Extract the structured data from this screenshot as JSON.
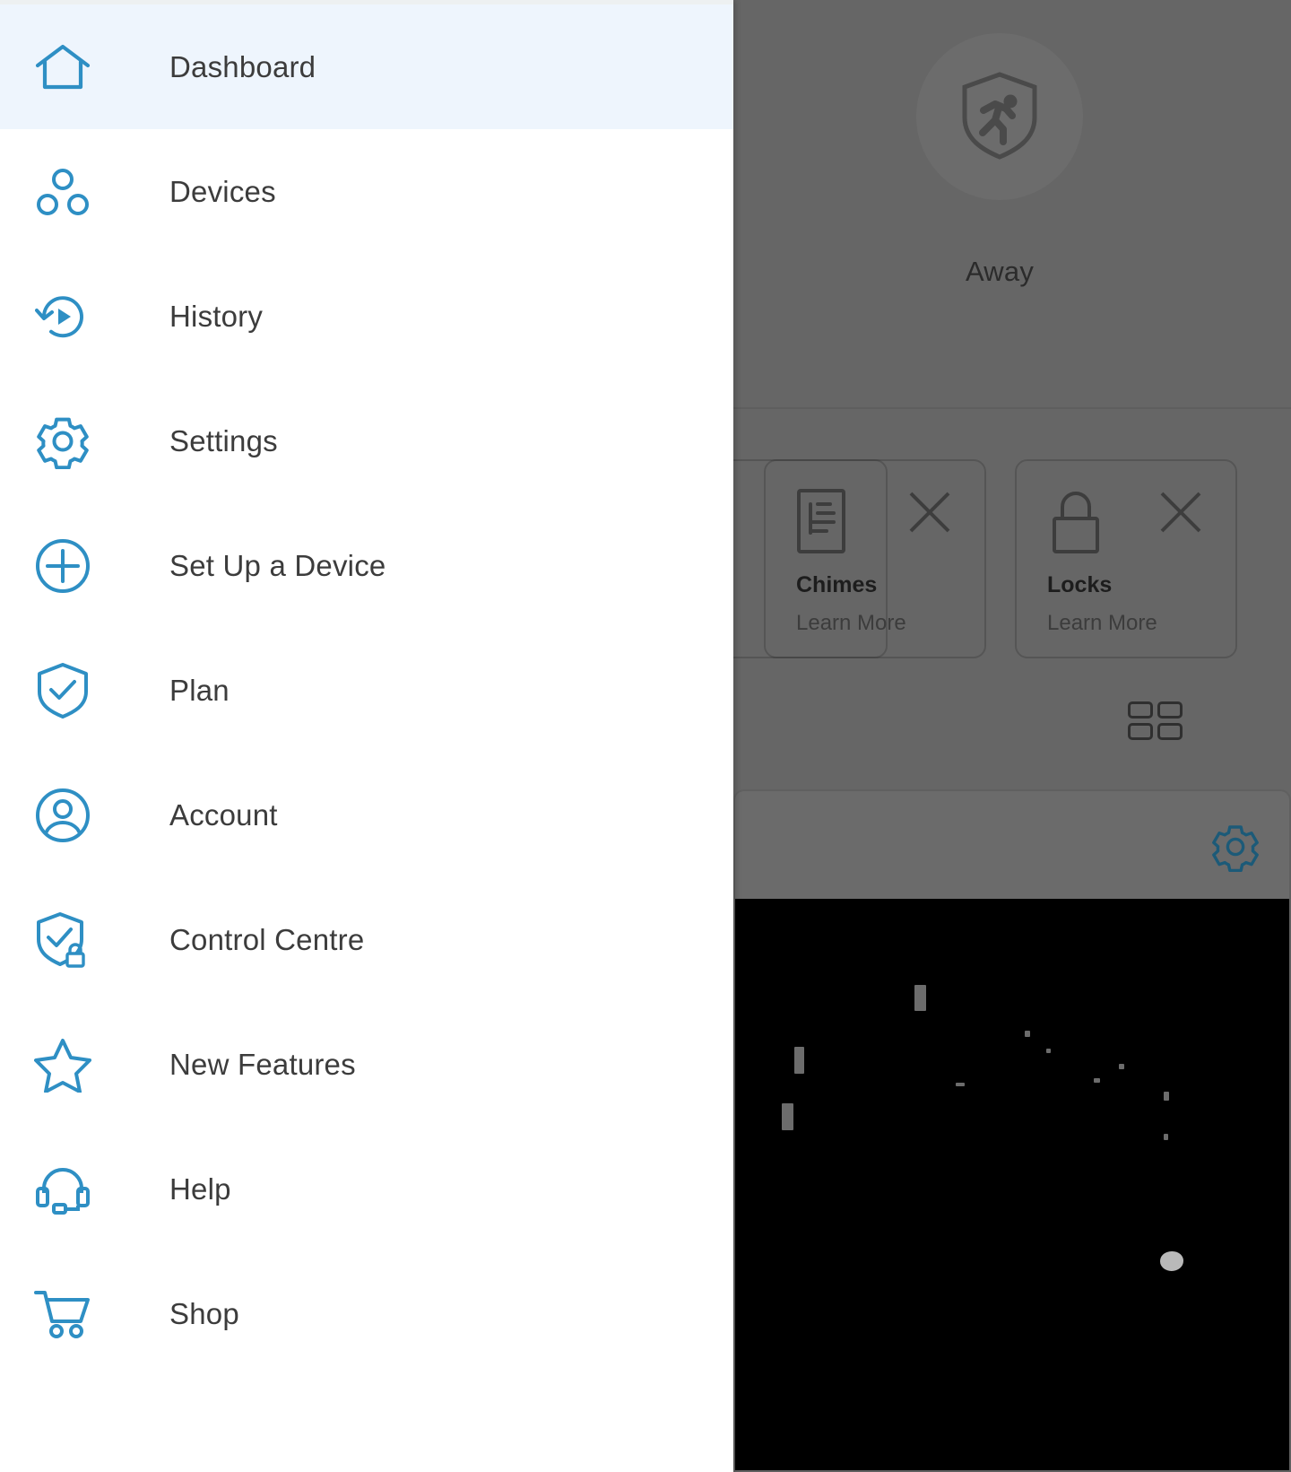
{
  "drawer": {
    "items": [
      {
        "label": "Dashboard",
        "icon": "home-icon",
        "active": true
      },
      {
        "label": "Devices",
        "icon": "devices-icon",
        "active": false
      },
      {
        "label": "History",
        "icon": "history-icon",
        "active": false
      },
      {
        "label": "Settings",
        "icon": "gear-icon",
        "active": false
      },
      {
        "label": "Set Up a Device",
        "icon": "plus-circle-icon",
        "active": false
      },
      {
        "label": "Plan",
        "icon": "shield-check-icon",
        "active": false
      },
      {
        "label": "Account",
        "icon": "user-circle-icon",
        "active": false
      },
      {
        "label": "Control Centre",
        "icon": "shield-lock-icon",
        "active": false
      },
      {
        "label": "New Features",
        "icon": "star-icon",
        "active": false
      },
      {
        "label": "Help",
        "icon": "headset-icon",
        "active": false
      },
      {
        "label": "Shop",
        "icon": "shopping-cart-icon",
        "active": false
      }
    ]
  },
  "dashboard": {
    "mode": {
      "label": "Away",
      "icon": "shield-running-person-icon"
    },
    "cards": [
      {
        "title": "Chimes",
        "link": "Learn More",
        "icon": "chime-document-icon",
        "close": "close-icon"
      },
      {
        "title": "Locks",
        "link": "Learn More",
        "icon": "padlock-icon",
        "close": "close-icon"
      }
    ],
    "view_toggle_icon": "grid-view-icon",
    "camera": {
      "settings_icon": "gear-icon"
    }
  },
  "colors": {
    "accent": "#2e8fc4",
    "text": "#3c3c3c",
    "active_row": "#eef5fd",
    "overlay": "#666666"
  }
}
